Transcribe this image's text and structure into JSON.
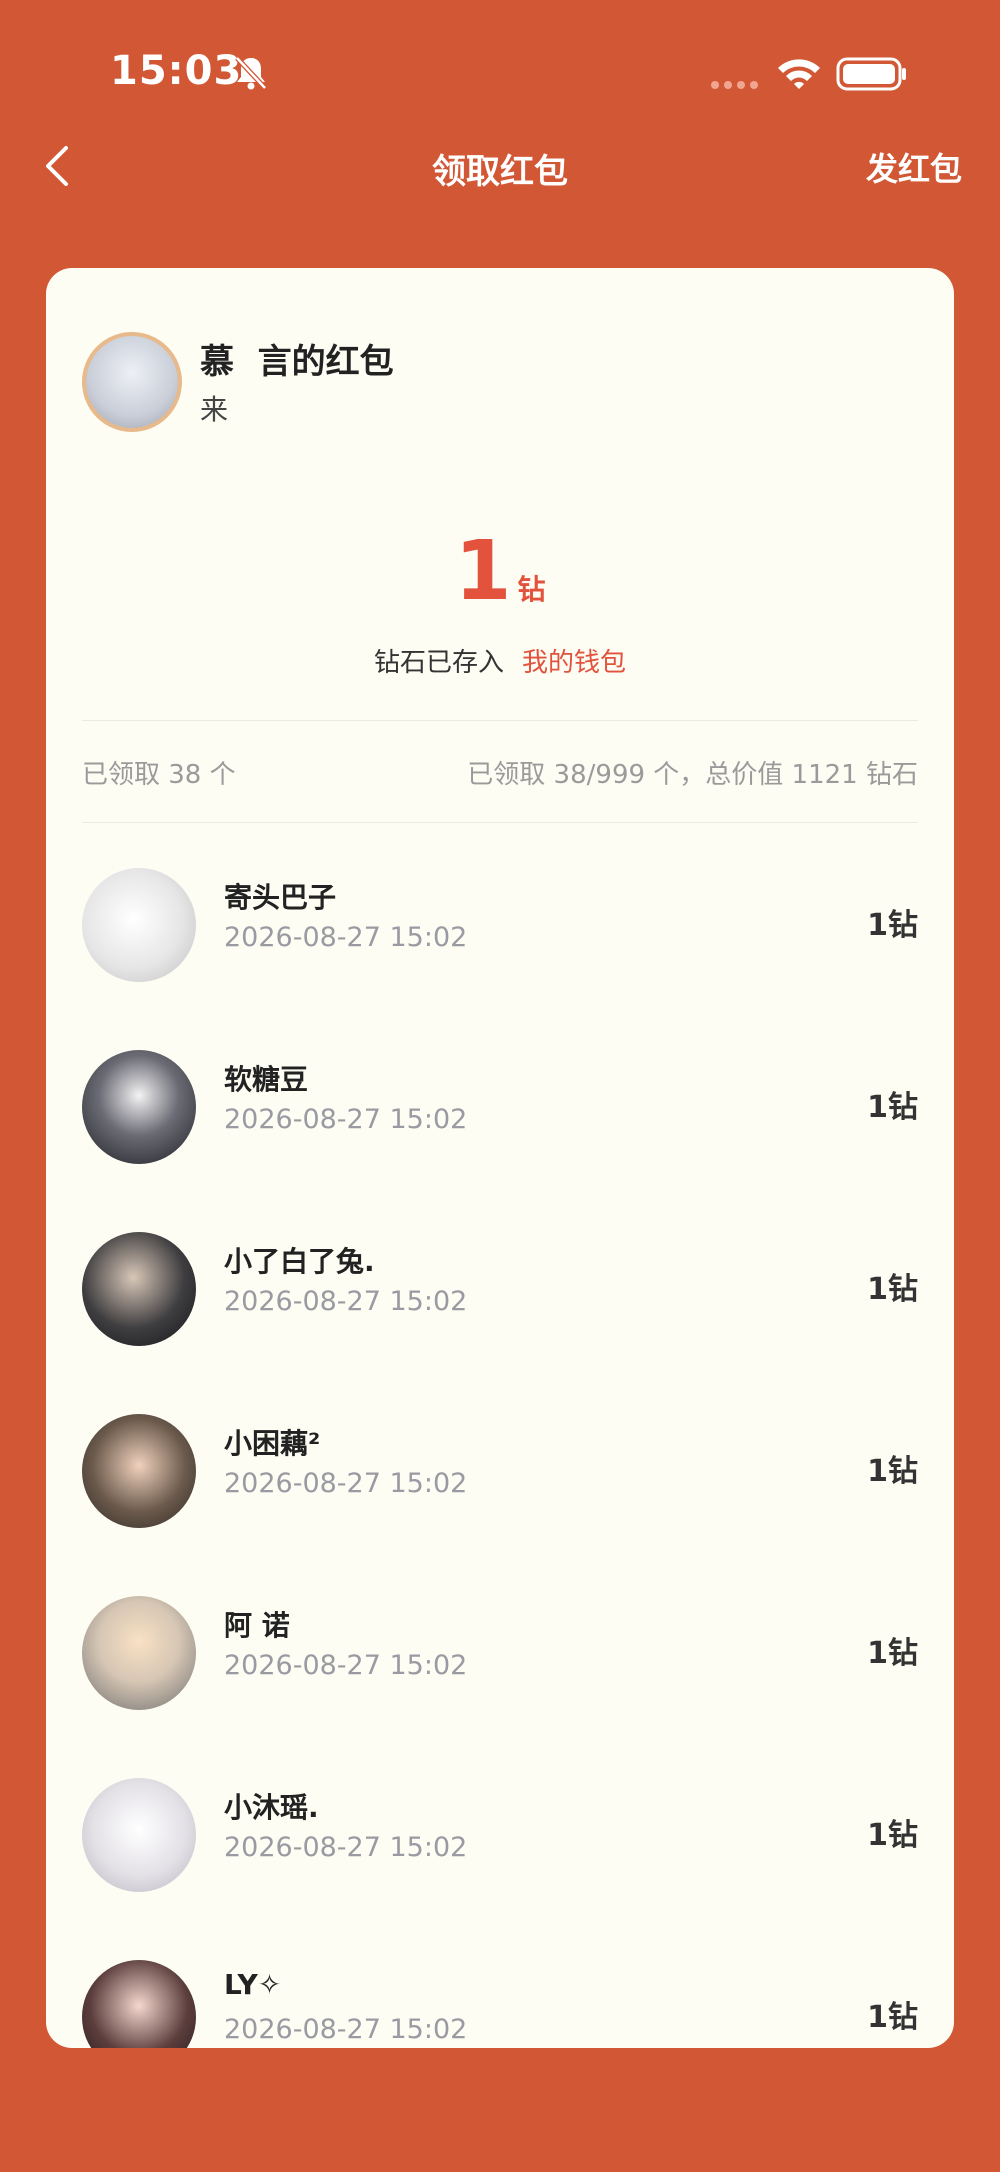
{
  "status": {
    "time": "15:03"
  },
  "nav": {
    "title": "领取红包",
    "action": "发红包"
  },
  "sender": {
    "name": "慕  言的红包",
    "subtitle": "来"
  },
  "amount": {
    "value": "1",
    "unit": "钻",
    "saved_text": "钻石已存入",
    "wallet_link": "我的钱包"
  },
  "summary": {
    "left": "已领取 38 个",
    "right": "已领取 38/999 个，总价值 1121 钻石"
  },
  "claims": [
    {
      "name": "寄头巴子",
      "date": "2026-08-27 15:02",
      "value": "1钻"
    },
    {
      "name": "软糖豆",
      "date": "2026-08-27 15:02",
      "value": "1钻"
    },
    {
      "name": "小了白了兔.",
      "date": "2026-08-27 15:02",
      "value": "1钻"
    },
    {
      "name": "小困藕²",
      "date": "2026-08-27 15:02",
      "value": "1钻"
    },
    {
      "name": "阿 诺",
      "date": "2026-08-27 15:02",
      "value": "1钻"
    },
    {
      "name": "小沐瑶.",
      "date": "2026-08-27 15:02",
      "value": "1钻"
    },
    {
      "name": "LY✧",
      "date": "2026-08-27 15:02",
      "value": "1钻"
    }
  ],
  "colors": {
    "background": "#d25735",
    "card": "#fdfdf4",
    "accent": "#e2523c"
  },
  "icons": [
    "mute-bell-icon",
    "signal-dots-icon",
    "wifi-icon",
    "battery-icon",
    "back-chevron-icon"
  ]
}
